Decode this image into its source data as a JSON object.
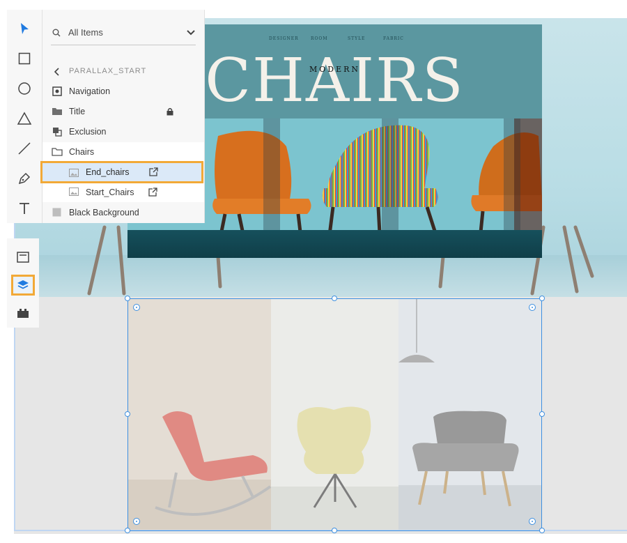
{
  "layers_panel": {
    "filter_label": "All Items",
    "breadcrumb": "PARALLAX_START",
    "items": [
      {
        "label": "Navigation",
        "icon": "symbol-icon"
      },
      {
        "label": "Title",
        "icon": "folder-filled-icon",
        "locked": true
      },
      {
        "label": "Exclusion",
        "icon": "boolean-group-icon"
      },
      {
        "label": "Chairs",
        "icon": "folder-outline-icon"
      },
      {
        "label": "End_chairs",
        "icon": "image-icon",
        "selected": true
      },
      {
        "label": "Start_Chairs",
        "icon": "image-icon"
      },
      {
        "label": "Black Background",
        "icon": "rectangle-fill-icon"
      }
    ]
  },
  "hero": {
    "nav": [
      "DESIGNER",
      "ROOM",
      "STYLE",
      "FABRIC"
    ],
    "eyebrow": "MODERN",
    "title": "CHAIRS"
  },
  "colors": {
    "accent_highlight": "#f2a937",
    "selection_blue": "#3d8fe0",
    "hero_teal": "#5b97a0"
  }
}
